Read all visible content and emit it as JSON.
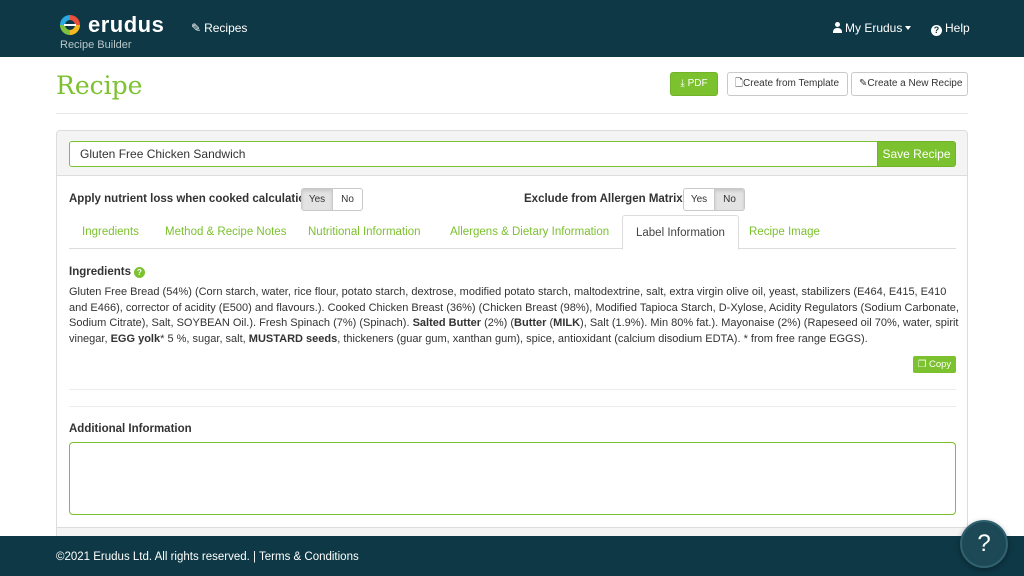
{
  "brand": {
    "name": "erudus",
    "subtitle": "Recipe Builder"
  },
  "nav": {
    "recipes": "Recipes",
    "my_erudus": "My Erudus",
    "help": "Help"
  },
  "page": {
    "title": "Recipe",
    "actions": {
      "pdf": "PDF",
      "create_from_template": "Create from Template",
      "create_new_recipe": "Create a New Recipe"
    }
  },
  "recipe": {
    "name": "Gluten Free Chicken Sandwich",
    "save_label": "Save Recipe"
  },
  "options": {
    "nutrient_loss": {
      "label": "Apply nutrient loss when cooked calculations :",
      "yes": "Yes",
      "no": "No",
      "selected": "Yes"
    },
    "exclude_allergen": {
      "label": "Exclude from Allergen Matrix? :",
      "yes": "Yes",
      "no": "No",
      "selected": "No"
    }
  },
  "tabs": [
    {
      "label": "Ingredients",
      "active": false
    },
    {
      "label": "Method & Recipe Notes",
      "active": false
    },
    {
      "label": "Nutritional Information",
      "active": false
    },
    {
      "label": "Allergens & Dietary Information",
      "active": false
    },
    {
      "label": "Label Information",
      "active": true
    },
    {
      "label": "Recipe Image",
      "active": false
    }
  ],
  "label_info": {
    "ingredients_heading": "Ingredients",
    "ingredients_text": [
      {
        "text": "Gluten Free Bread (54%) (Corn starch, water, rice flour, potato starch, dextrose, modified potato starch, maltodextrine, salt, extra virgin olive oil, yeast, stabilizers (E464, E415, E410 and E466), corrector of acidity (E500) and flavours.). Cooked Chicken Breast (36%) (Chicken Breast (98%), Modified Tapioca Starch, D-Xylose, Acidity Regulators (Sodium Carbonate, Sodium Citrate), Salt, SOYBEAN Oil.). Fresh Spinach (7%) (Spinach). ",
        "bold": false
      },
      {
        "text": "Salted Butter",
        "bold": true
      },
      {
        "text": " (2%) (",
        "bold": false
      },
      {
        "text": "Butter",
        "bold": true
      },
      {
        "text": " (",
        "bold": false
      },
      {
        "text": "MILK",
        "bold": true
      },
      {
        "text": "), Salt (1.9%). Min 80% fat.). Mayonaise (2%) (Rapeseed oil 70%, water, spirit vinegar, ",
        "bold": false
      },
      {
        "text": "EGG yolk",
        "bold": true
      },
      {
        "text": "* 5 %, sugar, salt, ",
        "bold": false
      },
      {
        "text": "MUSTARD seeds",
        "bold": true
      },
      {
        "text": ", thickeners (guar gum, xanthan gum), spice, antioxidant (calcium disodium EDTA). * from free range EGGS).",
        "bold": false
      }
    ],
    "copy_label": "Copy",
    "additional_heading": "Additional Information",
    "additional_value": ""
  },
  "footer": {
    "text": "©2021 Erudus Ltd. All rights reserved. | Terms & Conditions"
  },
  "help_fab": "?",
  "colors": {
    "navy": "#0e3845",
    "accent": "#7cc12e"
  }
}
